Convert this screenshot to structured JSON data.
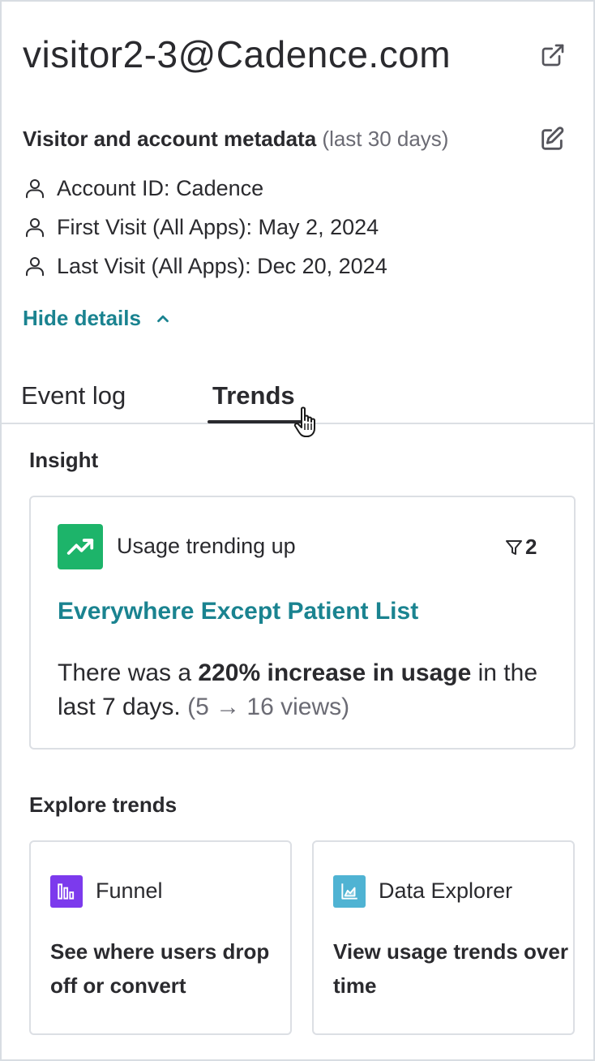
{
  "header": {
    "title": "visitor2-3@Cadence.com"
  },
  "metadata": {
    "heading_bold": "Visitor and account metadata",
    "heading_muted": "(last 30 days)",
    "rows": [
      {
        "label": "Account ID: Cadence"
      },
      {
        "label": "First Visit (All Apps): May 2, 2024"
      },
      {
        "label": "Last Visit (All Apps): Dec 20, 2024"
      }
    ],
    "toggle_label": "Hide details"
  },
  "tabs": [
    {
      "label": "Event log",
      "active": false
    },
    {
      "label": "Trends",
      "active": true
    }
  ],
  "insight": {
    "section_label": "Insight",
    "type_label": "Usage trending up",
    "filter_count": "2",
    "link_label": "Everywhere Except Patient List",
    "text_prefix": "There was a ",
    "text_bold": "220% increase in usage",
    "text_mid": " in the last 7 days. ",
    "text_muted": "(5 → 16 views)"
  },
  "explore": {
    "section_label": "Explore trends",
    "cards": [
      {
        "title": "Funnel",
        "description": "See where users drop off or convert",
        "icon": "funnel-chart-icon",
        "color": "#7c3aed"
      },
      {
        "title": "Data Explorer",
        "description": "View usage trends over time",
        "icon": "area-chart-icon",
        "color": "#4fb3d3"
      }
    ]
  },
  "colors": {
    "accent": "#1a8390",
    "trend_green": "#1db46a"
  }
}
